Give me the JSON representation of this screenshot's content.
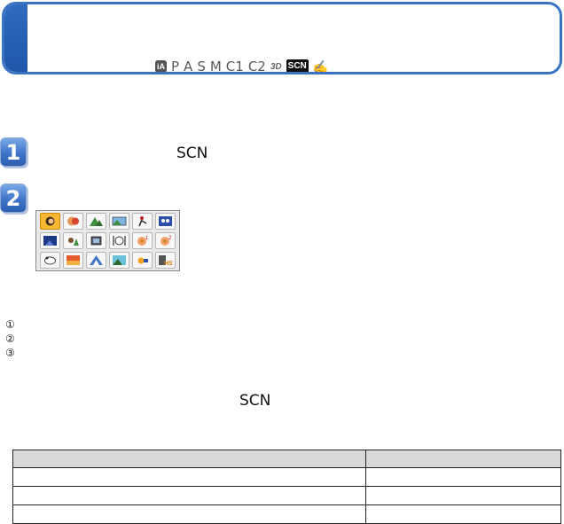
{
  "header": {
    "modes": {
      "ia": "iA",
      "p": "P",
      "a": "A",
      "s": "S",
      "m": "M",
      "c1": "C1",
      "c2": "C2",
      "three_d": "3D",
      "scn": "SCN",
      "creative_icon": "creative-control-icon"
    },
    "accent_color": "#3a73c4"
  },
  "steps": [
    {
      "number": "1",
      "scn_label": "SCN"
    },
    {
      "number": "2"
    }
  ],
  "scene_menu": {
    "selected_index": 0,
    "icons": [
      "portrait-icon",
      "soft-skin-icon",
      "scenery-icon",
      "panorama-icon",
      "sports-icon",
      "baby-icon",
      "night-scenery-icon",
      "night-portrait-icon",
      "handheld-night-icon",
      "food-icon",
      "baby1-icon",
      "baby2-icon",
      "pet-icon",
      "sunset-icon",
      "high-sensitivity-icon",
      "through-glass-icon",
      "party-icon",
      "hs-burst-icon"
    ]
  },
  "numbered_markers": [
    "①",
    "②",
    "③"
  ],
  "note": {
    "scn_label": "SCN"
  },
  "table": {
    "rows": 4
  }
}
